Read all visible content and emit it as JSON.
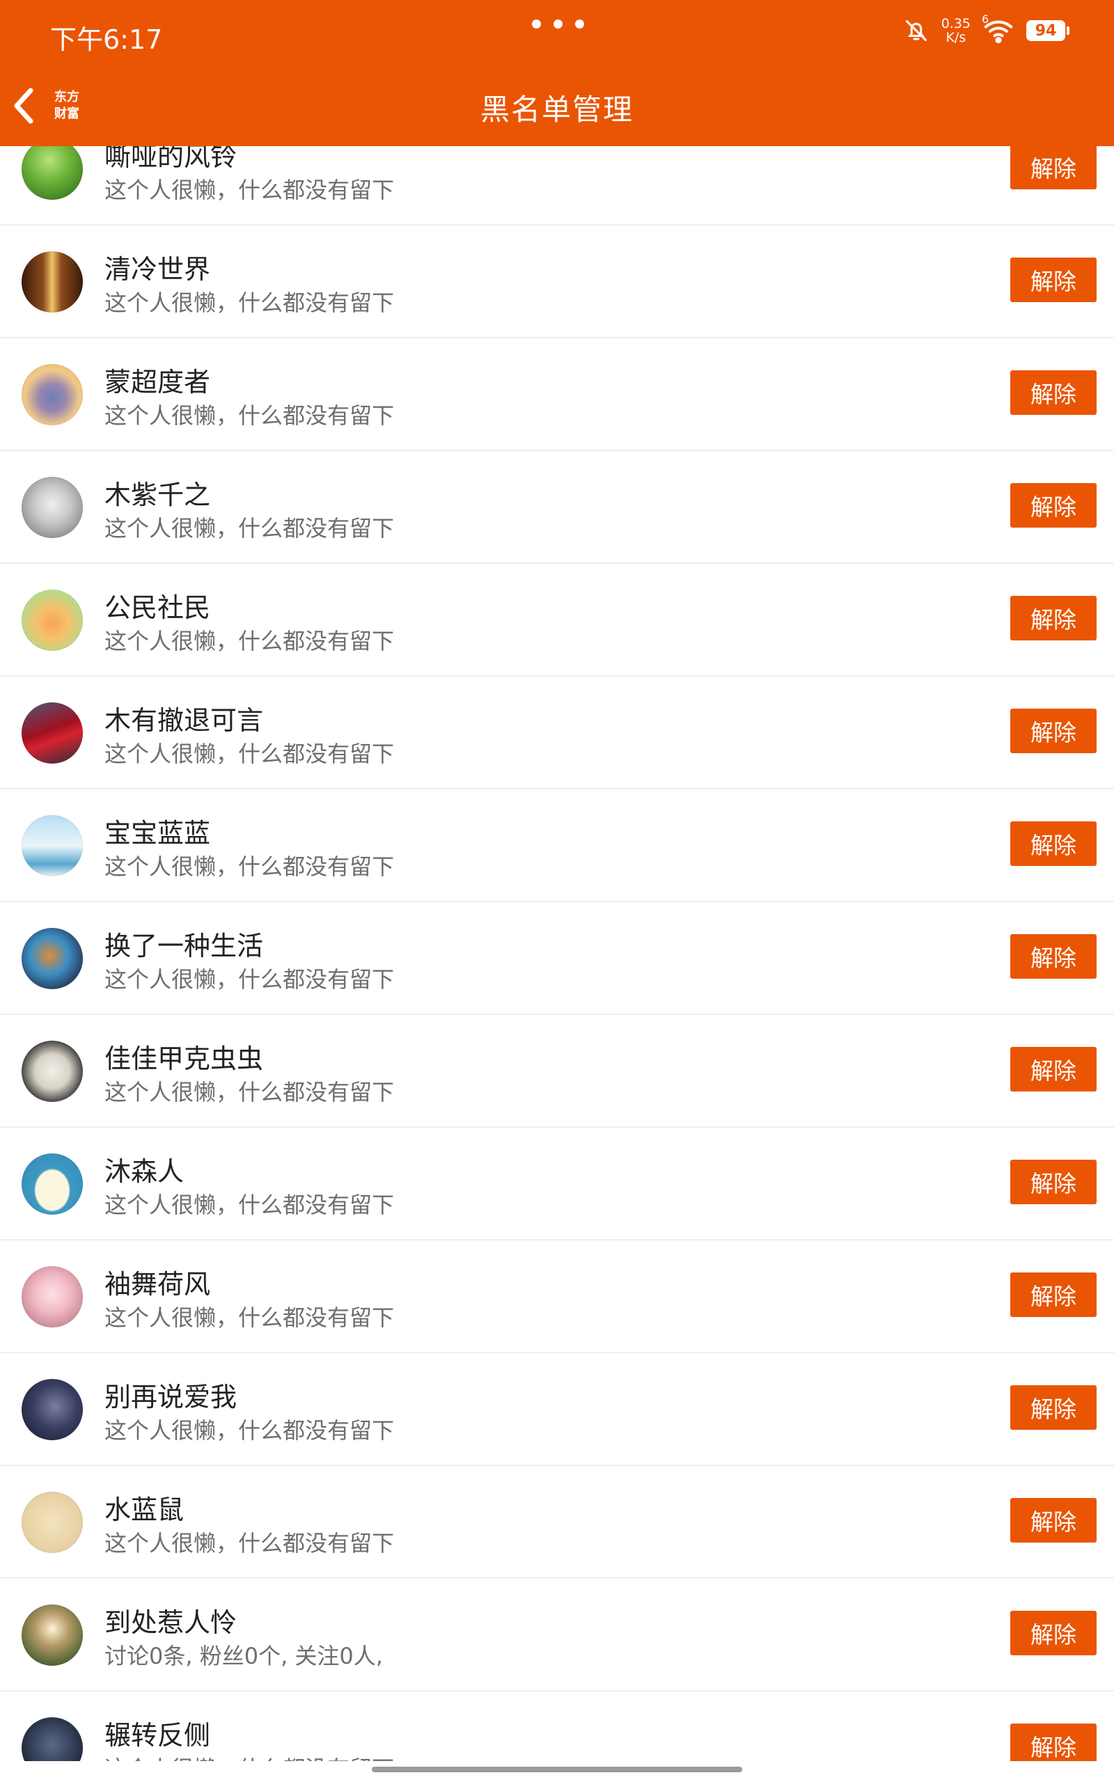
{
  "status_bar": {
    "time": "下午6:17",
    "speed_value": "0.35",
    "speed_unit": "K/s",
    "signal_label": "6",
    "battery": "94"
  },
  "header": {
    "title": "黑名单管理",
    "logo_line1": "东方",
    "logo_line2": "财富"
  },
  "colors": {
    "accent": "#EA5504"
  },
  "list": {
    "items": [
      {
        "name": "嘶哑的风铃",
        "desc": "这个人很懒，什么都没有留下",
        "button": "解除",
        "avatar": "green-plant"
      },
      {
        "name": "清冷世界",
        "desc": "这个人很懒，什么都没有留下",
        "button": "解除",
        "avatar": "brown-fire"
      },
      {
        "name": "蒙超度者",
        "desc": "这个人很懒，什么都没有留下",
        "button": "解除",
        "avatar": "sage-figure"
      },
      {
        "name": "木紫千之",
        "desc": "这个人很懒，什么都没有留下",
        "button": "解除",
        "avatar": "grey-cat"
      },
      {
        "name": "公民社民",
        "desc": "这个人很懒，什么都没有留下",
        "button": "解除",
        "avatar": "cartoon-cat"
      },
      {
        "name": "木有撤退可言",
        "desc": "这个人很懒，什么都没有留下",
        "button": "解除",
        "avatar": "red-car"
      },
      {
        "name": "宝宝蓝蓝",
        "desc": "这个人很懒，什么都没有留下",
        "button": "解除",
        "avatar": "beach-couple"
      },
      {
        "name": "换了一种生活",
        "desc": "这个人很懒，什么都没有留下",
        "button": "解除",
        "avatar": "kingfisher"
      },
      {
        "name": "佳佳甲克虫虫",
        "desc": "这个人很懒，什么都没有留下",
        "button": "解除",
        "avatar": "ink-drawing"
      },
      {
        "name": "沐森人",
        "desc": "这个人很懒，什么都没有留下",
        "button": "解除",
        "avatar": "cloud"
      },
      {
        "name": "袖舞荷风",
        "desc": "这个人很懒，什么都没有留下",
        "button": "解除",
        "avatar": "anime-girl"
      },
      {
        "name": "别再说爱我",
        "desc": "这个人很懒，什么都没有留下",
        "button": "解除",
        "avatar": "dark-photo"
      },
      {
        "name": "水蓝鼠",
        "desc": "这个人很懒，什么都没有留下",
        "button": "解除",
        "avatar": "calligraphy"
      },
      {
        "name": "到处惹人怜",
        "desc": "讨论0条, 粉丝0个, 关注0人,",
        "button": "解除",
        "avatar": "outdoor-person"
      },
      {
        "name": "辗转反侧",
        "desc": "这个人很懒，什么都没有留下",
        "button": "解除",
        "avatar": "dark-photo-2"
      }
    ]
  }
}
